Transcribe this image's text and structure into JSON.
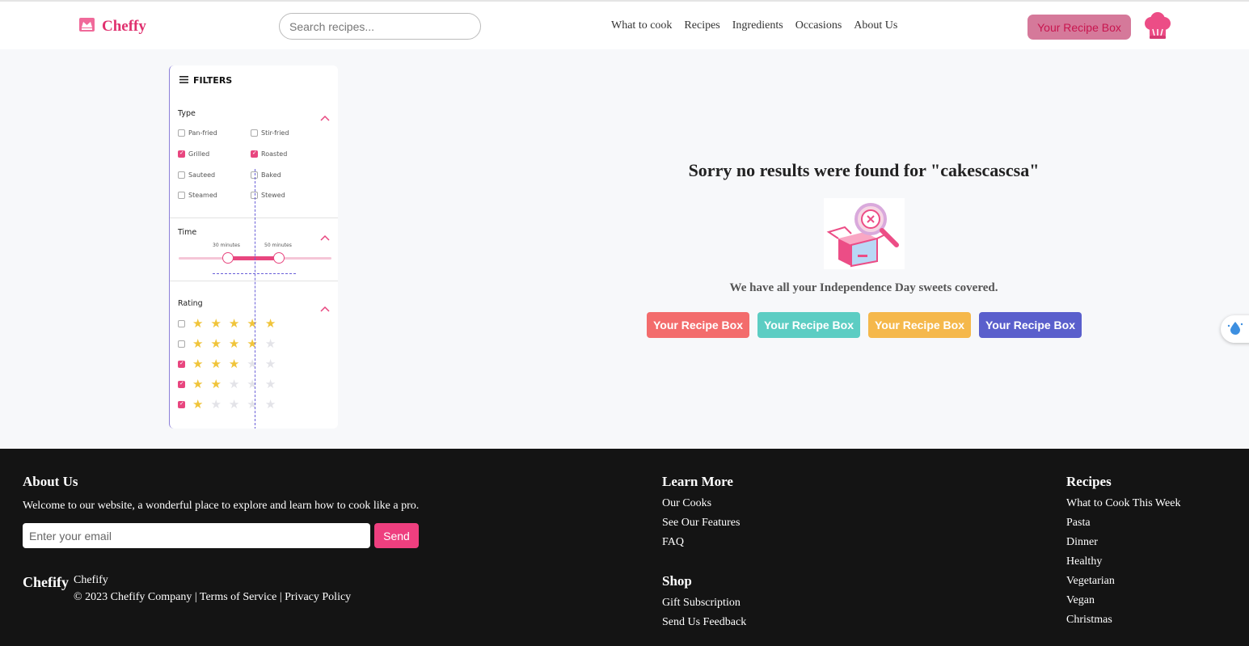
{
  "header": {
    "logo_text": "Cheffy",
    "search_placeholder": "Search recipes...",
    "nav": [
      "What to cook",
      "Recipes",
      "Ingredients",
      "Occasions",
      "About Us"
    ],
    "recipe_box_label": "Your Recipe Box",
    "avatar_icon": "chef-hat-icon"
  },
  "filters": {
    "title": "FILTERS",
    "type": {
      "title": "Type",
      "options": [
        {
          "label": "Pan-fried",
          "checked": false
        },
        {
          "label": "Stir-fried",
          "checked": false
        },
        {
          "label": "Grilled",
          "checked": true
        },
        {
          "label": "Roasted",
          "checked": true
        },
        {
          "label": "Sauteed",
          "checked": false
        },
        {
          "label": "Baked",
          "checked": false
        },
        {
          "label": "Steamed",
          "checked": false
        },
        {
          "label": "Stewed",
          "checked": false
        }
      ]
    },
    "time": {
      "title": "Time",
      "min_label": "30 minutes",
      "max_label": "50 minutes"
    },
    "rating": {
      "title": "Rating",
      "rows": [
        {
          "stars": 5,
          "checked": false
        },
        {
          "stars": 4,
          "checked": false
        },
        {
          "stars": 3,
          "checked": true
        },
        {
          "stars": 2,
          "checked": true
        },
        {
          "stars": 1,
          "checked": true
        }
      ]
    }
  },
  "results": {
    "message": "Sorry no results were found for \"cakescascsa\"",
    "illustration_icon": "empty-box-search-icon",
    "subtitle": "We have all your Independence Day sweets covered.",
    "buttons": [
      {
        "label": "Your Recipe Box",
        "color": "#f36c6c"
      },
      {
        "label": "Your Recipe Box",
        "color": "#5ccdc3"
      },
      {
        "label": "Your Recipe Box",
        "color": "#f5b84b"
      },
      {
        "label": "Your Recipe Box",
        "color": "#5a5fcc"
      }
    ]
  },
  "footer": {
    "about": {
      "title": "About Us",
      "text": "Welcome to our website, a wonderful place to explore and learn how to cook like a pro.",
      "email_placeholder": "Enter your email",
      "send_label": "Send"
    },
    "brand": "Chefify",
    "brand_small": "Chefify",
    "copyright": "© 2023 Chefify Company | Terms of Service | Privacy Policy",
    "learn_more": {
      "title": "Learn More",
      "items": [
        "Our Cooks",
        "See Our Features",
        "FAQ"
      ]
    },
    "shop": {
      "title": "Shop",
      "items": [
        "Gift Subscription",
        "Send Us Feedback"
      ]
    },
    "recipes": {
      "title": "Recipes",
      "items": [
        "What to Cook This Week",
        "Pasta",
        "Dinner",
        "Healthy",
        "Vegetarian",
        "Vegan",
        "Christmas"
      ]
    }
  },
  "colors": {
    "brand": "#e0316f",
    "accent": "#e8467f",
    "footer_bg": "#141414"
  }
}
